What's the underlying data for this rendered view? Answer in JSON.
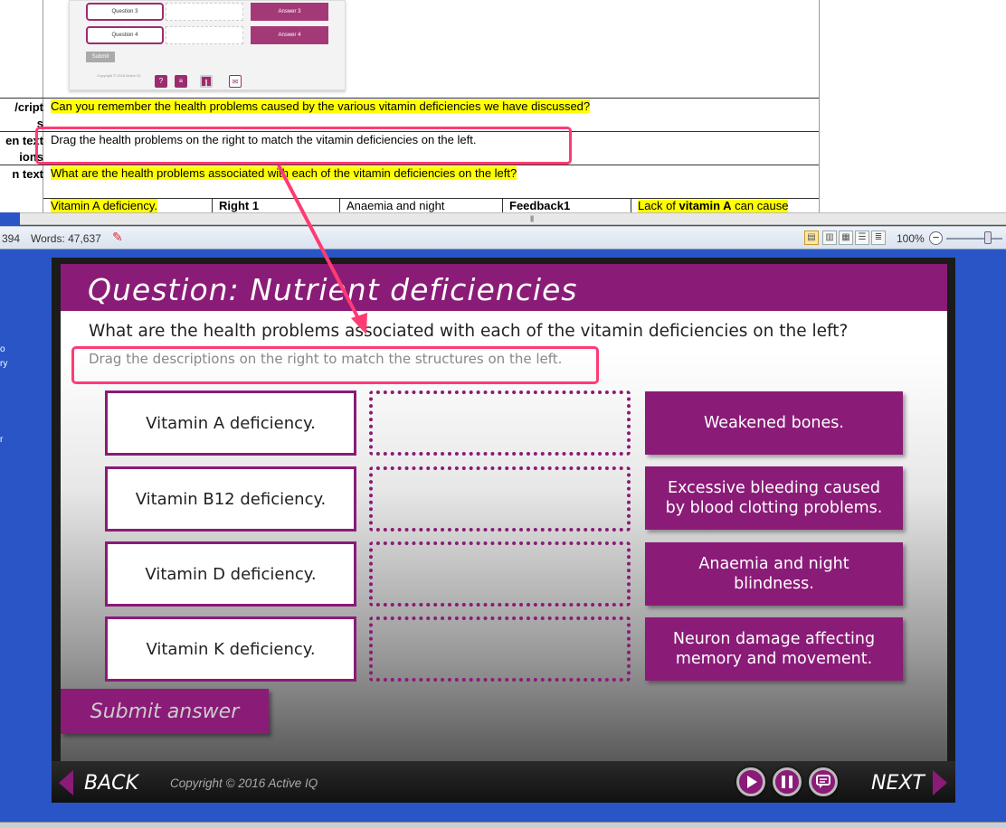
{
  "document": {
    "thumbnail": {
      "questions": [
        "Question 3",
        "Question 4"
      ],
      "answers": [
        "Answer 3",
        "Answer 4"
      ],
      "submit": "Submit",
      "copyright": "Copyright © 2016 Active IQ"
    },
    "rows": [
      {
        "label": "cript/\ns",
        "text": "Can you remember the health problems caused by the various vitamin deficiencies we have discussed?",
        "highlight": true
      },
      {
        "label": "en text\nions",
        "text": "Drag the health problems on the right to match the vitamin deficiencies on the left.",
        "highlight": false
      },
      {
        "label": "n text",
        "text": "What are the health problems associated with each of the vitamin deficiencies on the left?",
        "highlight": true
      }
    ],
    "table_row": {
      "c1": "Vitamin A deficiency.",
      "c2": "Right 1",
      "c3": "Anaemia and night",
      "c4": "Feedback1",
      "c5_prefix": "Lack of ",
      "c5_bold": "vitamin A",
      "c5_suffix": " can cause"
    }
  },
  "statusbar": {
    "page_fragment": "394",
    "words": "Words: 47,637",
    "zoom": "100%",
    "zoom_level_percent": 100
  },
  "side_text": [
    "o",
    "ry",
    "r"
  ],
  "slide": {
    "title": "Question: Nutrient deficiencies",
    "question": "What are the health problems associated with each of the vitamin deficiencies on the left?",
    "instruction": "Drag the descriptions on the right to match the structures on the left.",
    "left_items": [
      "Vitamin A deficiency.",
      "Vitamin B12 deficiency.",
      "Vitamin D deficiency.",
      "Vitamin K deficiency."
    ],
    "right_items": [
      "Weakened bones.",
      "Excessive bleeding caused by blood clotting problems.",
      "Anaemia and night blindness.",
      "Neuron damage affecting memory and movement."
    ],
    "submit": "Submit answer"
  },
  "nav": {
    "back": "BACK",
    "next": "NEXT",
    "copyright": "Copyright © 2016 Active IQ"
  },
  "colors": {
    "brand": "#8a1b77",
    "annotation": "#ff3b74",
    "highlight": "#ffff00"
  }
}
